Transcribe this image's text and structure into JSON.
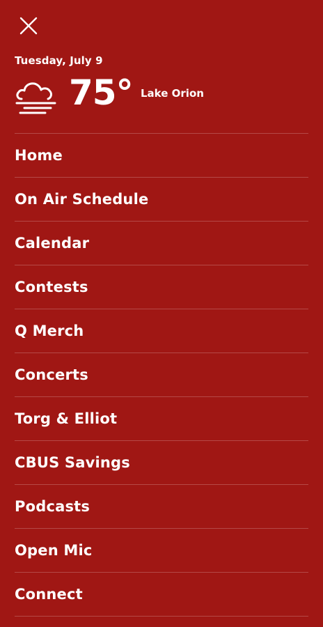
{
  "header": {
    "close_icon": "close-icon"
  },
  "weather": {
    "date": "Tuesday, July 9",
    "icon": "cloud-fog-icon",
    "temperature": "75°",
    "location": "Lake Orion"
  },
  "menu": {
    "items": [
      {
        "label": "Home"
      },
      {
        "label": "On Air Schedule"
      },
      {
        "label": "Calendar"
      },
      {
        "label": "Contests"
      },
      {
        "label": "Q Merch"
      },
      {
        "label": "Concerts"
      },
      {
        "label": "Torg & Elliot"
      },
      {
        "label": "CBUS Savings"
      },
      {
        "label": "Podcasts"
      },
      {
        "label": "Open Mic"
      },
      {
        "label": "Connect"
      }
    ]
  },
  "colors": {
    "background": "#a01714",
    "text": "#ffffff",
    "divider": "rgba(255,255,255,0.22)"
  }
}
